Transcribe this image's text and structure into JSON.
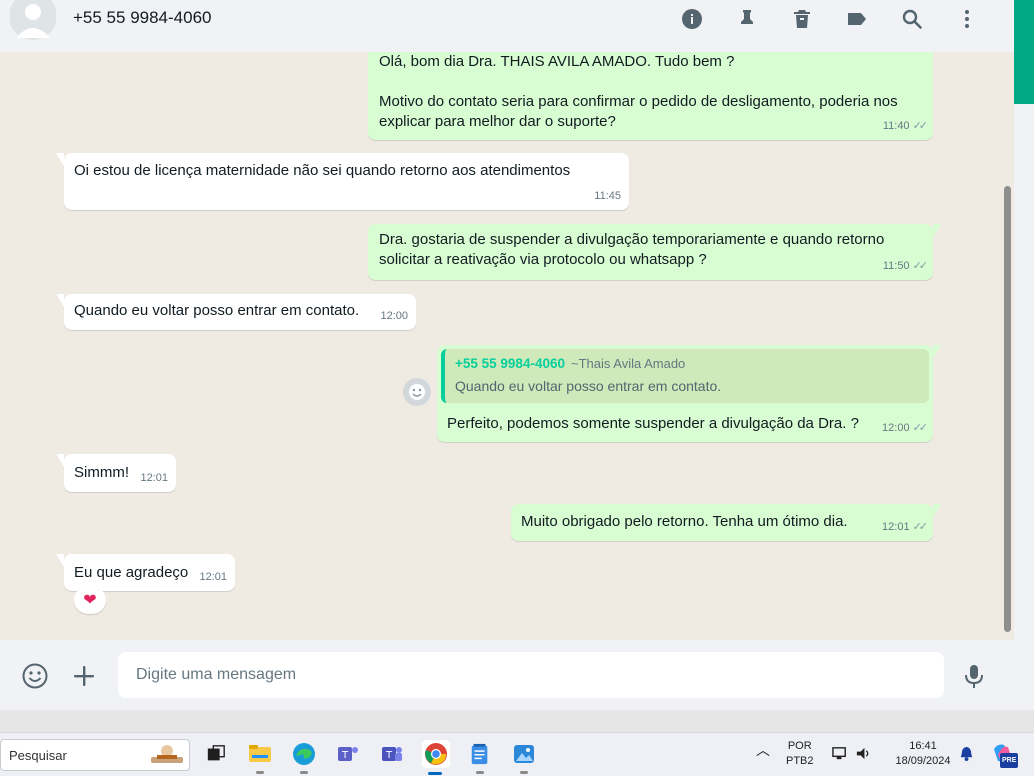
{
  "header": {
    "contact_name": "+55 55 9984-4060",
    "icons": [
      "info-icon",
      "pin-icon",
      "delete-icon",
      "label-icon",
      "search-icon",
      "menu-icon"
    ]
  },
  "messages": [
    {
      "dir": "out",
      "text": "Olá, bom dia Dra. THAIS AVILA AMADO. Tudo bem ?\n\nMotivo do contato seria para confirmar o pedido de desligamento, poderia nos explicar para melhor dar o suporte?",
      "time": "11:40"
    },
    {
      "dir": "in",
      "text": "Oi estou de licença maternidade não sei quando retorno aos atendimentos",
      "time": "11:45"
    },
    {
      "dir": "out",
      "text": "Dra. gostaria de suspender a divulgação temporariamente e quando retorno solicitar a reativação via protocolo ou whatsapp ?",
      "time": "11:50"
    },
    {
      "dir": "in",
      "text": "Quando eu voltar posso entrar em contato.",
      "time": "12:00"
    },
    {
      "dir": "out",
      "quote": {
        "name": "+55 55 9984-4060",
        "pushname": "~Thais Avila Amado",
        "text": "Quando eu voltar posso entrar em contato."
      },
      "text": "Perfeito, podemos somente suspender a divulgação da Dra. ?",
      "time": "12:00"
    },
    {
      "dir": "in",
      "text": "Simmm!",
      "time": "12:01"
    },
    {
      "dir": "out",
      "text": "Muito obrigado pelo retorno. Tenha um ótimo dia.",
      "time": "12:01"
    },
    {
      "dir": "in",
      "text": "Eu que agradeço",
      "time": "12:01",
      "reaction": "❤"
    }
  ],
  "composer": {
    "placeholder": "Digite uma mensagem"
  },
  "taskbar": {
    "search_placeholder": "Pesquisar",
    "lang_top": "POR",
    "lang_bottom": "PTB2",
    "time": "16:41",
    "date": "18/09/2024",
    "copilot_badge": "PRE"
  },
  "colors": {
    "out_bubble": "#d9fdd3",
    "in_bubble": "#ffffff",
    "accent": "#00a884",
    "quote_name": "#06cf9c"
  }
}
